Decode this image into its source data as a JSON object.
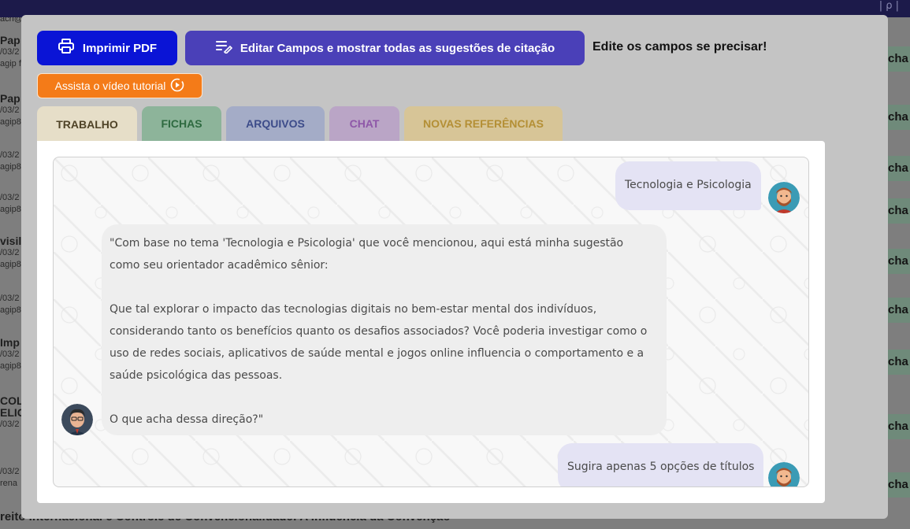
{
  "background": {
    "top_right": "| ρ |",
    "acri": "acri@",
    "left_items": [
      {
        "title": "Pap",
        "sub1": "/03/2",
        "sub2": "agip fi"
      },
      {
        "title": "Pap",
        "sub1": "/03/2",
        "sub2": "agip8"
      },
      {
        "title": "",
        "sub1": "/03/2",
        "sub2": "agip8"
      },
      {
        "title": "",
        "sub1": "/03/2",
        "sub2": "agip8"
      },
      {
        "title": "visil",
        "sub1": "/03/2",
        "sub2": "agip8"
      },
      {
        "title": "",
        "sub1": "/03/2",
        "sub2": "agip8"
      },
      {
        "title": "Imp",
        "sub1": "/03/2",
        "sub2": "agip8"
      },
      {
        "title": "COL",
        "sub1": "ELIGI",
        "sub2": "/03/2"
      },
      {
        "title": "",
        "sub1": "/03/2",
        "sub2": "rena"
      }
    ],
    "right_label": "cha",
    "bottom_text": "reito Internacional e Controle de Convencionalidade: A Influência da Convenção"
  },
  "toolbar": {
    "print_label": "Imprimir PDF",
    "edit_label": "Editar Campos e mostrar todas as sugestões de citação",
    "hint": "Edite os campos se precisar!",
    "tutorial_label": "Assista o vídeo tutorial"
  },
  "tabs": [
    {
      "label": "TRABALHO"
    },
    {
      "label": "FICHAS"
    },
    {
      "label": "ARQUIVOS"
    },
    {
      "label": "CHAT"
    },
    {
      "label": "NOVAS REFERÊNCIAS"
    }
  ],
  "chat": {
    "messages": [
      {
        "role": "user",
        "text": "Tecnologia e Psicologia"
      },
      {
        "role": "assistant",
        "lines": [
          "\"Com base no tema 'Tecnologia e Psicologia' que você mencionou, aqui está minha sugestão",
          "como seu orientador acadêmico sênior:",
          "",
          "Que tal explorar o impacto das tecnologias digitais no bem-estar mental dos indivíduos,",
          "considerando tanto os benefícios quanto os desafios associados? Você poderia investigar como o",
          "uso de redes sociais, aplicativos de saúde mental e jogos online influencia o comportamento e a",
          "saúde psicológica das pessoas.",
          "",
          "O que acha dessa direção?\""
        ]
      },
      {
        "role": "user",
        "text": "Sugira apenas 5 opções de títulos"
      }
    ]
  },
  "colors": {
    "print_button": "#0a14d6",
    "edit_button": "#4a40b8",
    "tutorial_button": "#f47b18",
    "user_bubble": "#e4e3f4",
    "assistant_bubble": "#eeeeee"
  }
}
